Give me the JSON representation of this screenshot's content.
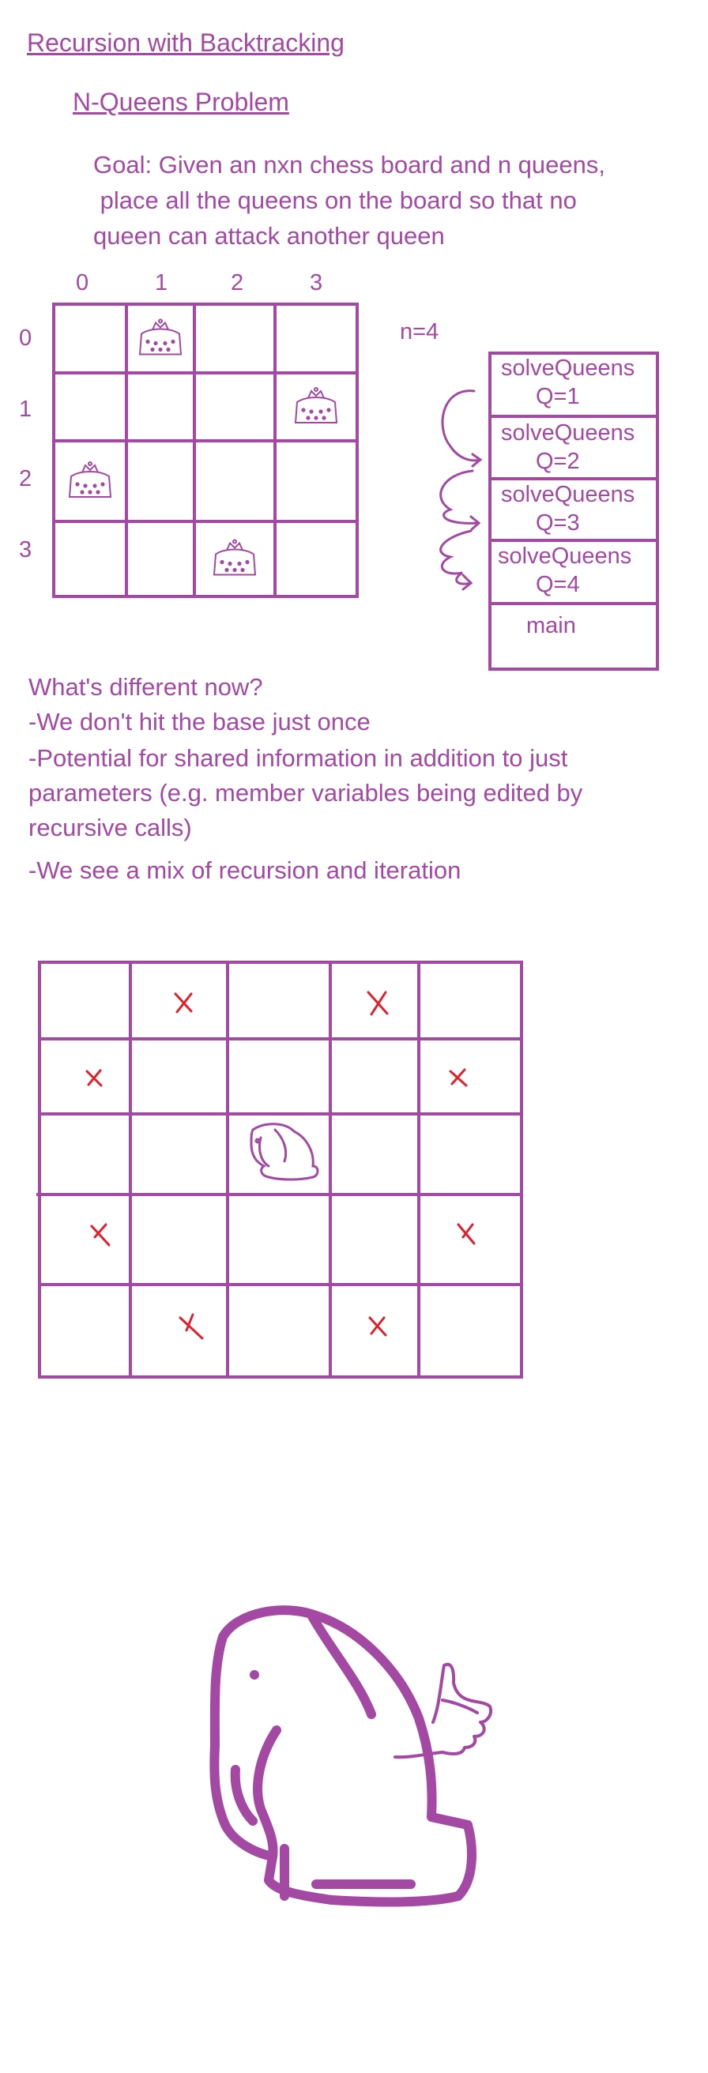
{
  "heading": "Recursion with Backtracking",
  "subheading": "N-Queens Problem",
  "goal_lines": [
    "Goal: Given an nxn chess board and n queens,",
    " place all the queens on the board so that no",
    "queen can attack another queen"
  ],
  "board": {
    "col_labels": [
      "0",
      "1",
      "2",
      "3"
    ],
    "row_labels": [
      "0",
      "1",
      "2",
      "3"
    ],
    "queens": [
      {
        "row": 0,
        "col": 1
      },
      {
        "row": 1,
        "col": 3
      },
      {
        "row": 2,
        "col": 0
      },
      {
        "row": 3,
        "col": 2
      }
    ]
  },
  "n_label": "n=4",
  "call_stack": {
    "frames": [
      {
        "name": "solveQueens",
        "arg": "Q=1"
      },
      {
        "name": "solveQueens",
        "arg": "Q=2"
      },
      {
        "name": "solveQueens",
        "arg": "Q=3"
      },
      {
        "name": "solveQueens",
        "arg": "Q=4"
      }
    ],
    "bottom": "main"
  },
  "differences": {
    "question": "What's different now?",
    "lines": [
      "-We don't hit the base just once",
      "-Potential for shared information in addition to just",
      "parameters (e.g. member variables being edited by",
      "recursive calls)",
      "-We see a mix of recursion and iteration"
    ]
  },
  "colors": {
    "ink": "#a349a4",
    "mark": "#e0202a"
  }
}
